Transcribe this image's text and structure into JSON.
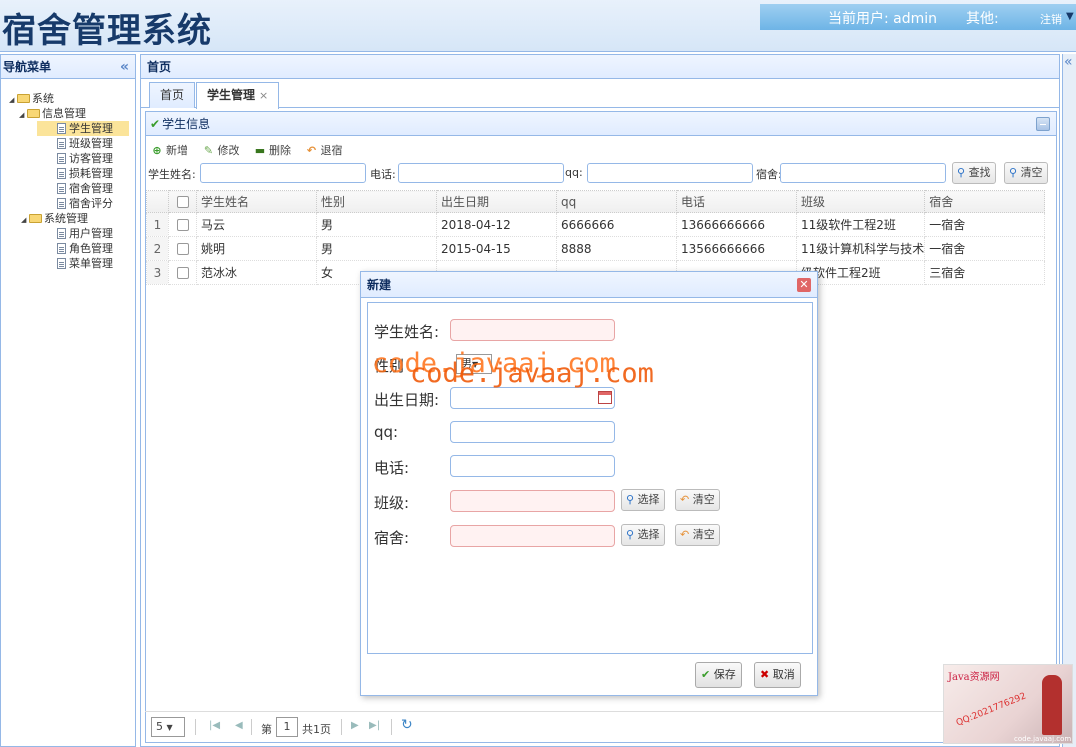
{
  "header": {
    "title": "宿舍管理系统",
    "current_user_label": "当前用户: admin",
    "other_label": "其他:",
    "logout_label": "注销"
  },
  "sidebar": {
    "title": "导航菜单",
    "tree": [
      {
        "label": "系统",
        "level": 0,
        "type": "folder"
      },
      {
        "label": "信息管理",
        "level": 1,
        "type": "folder"
      },
      {
        "label": "学生管理",
        "level": 2,
        "type": "file",
        "selected": true
      },
      {
        "label": "班级管理",
        "level": 2,
        "type": "file"
      },
      {
        "label": "访客管理",
        "level": 2,
        "type": "file"
      },
      {
        "label": "损耗管理",
        "level": 2,
        "type": "file"
      },
      {
        "label": "宿舍管理",
        "level": 2,
        "type": "file"
      },
      {
        "label": "宿舍评分",
        "level": 2,
        "type": "file"
      },
      {
        "label": "系统管理",
        "level": 1,
        "type": "folder"
      },
      {
        "label": "用户管理",
        "level": 2,
        "type": "file"
      },
      {
        "label": "角色管理",
        "level": 2,
        "type": "file"
      },
      {
        "label": "菜单管理",
        "level": 2,
        "type": "file"
      }
    ]
  },
  "main": {
    "title": "首页",
    "tabs": [
      {
        "label": "首页"
      },
      {
        "label": "学生管理",
        "closable": "×"
      }
    ],
    "panel_title": "学生信息",
    "toolbar": {
      "add": "新增",
      "edit": "修改",
      "delete": "删除",
      "back": "退宿"
    },
    "search": {
      "name_label": "学生姓名:",
      "phone_label": "电话:",
      "qq_label": "qq:",
      "dorm_label": "宿舍:",
      "find_button": "查找",
      "clear_button": "清空"
    },
    "table": {
      "columns": [
        "学生姓名",
        "性别",
        "出生日期",
        "qq",
        "电话",
        "班级",
        "宿舍"
      ],
      "rows": [
        {
          "num": "1",
          "cells": [
            "马云",
            "男",
            "2018-04-12",
            "6666666",
            "13666666666",
            "11级软件工程2班",
            "一宿舍"
          ]
        },
        {
          "num": "2",
          "cells": [
            "姚明",
            "男",
            "2015-04-15",
            "8888",
            "13566666666",
            "11级计算机科学与技术",
            "一宿舍"
          ]
        },
        {
          "num": "3",
          "cells": [
            "范冰冰",
            "女",
            "",
            "",
            "",
            "级软件工程2班",
            "三宿舍"
          ]
        }
      ]
    },
    "pager": {
      "page_size": "5",
      "page_prefix": "第",
      "page_value": "1",
      "page_total": "共1页"
    }
  },
  "dialog": {
    "title": "新建",
    "fields": {
      "name": "学生姓名:",
      "sex": "性别",
      "sex_value": "男",
      "birth": "出生日期:",
      "qq": "qq:",
      "phone": "电话:",
      "class": "班级:",
      "dorm": "宿舍:"
    },
    "select_button": "选择",
    "clear_button": "清空",
    "save_button": "保存",
    "cancel_button": "取消"
  },
  "watermark": "code.javaaj.com",
  "corner_ad": {
    "title": "Java资源网",
    "qq": "QQ:2021776292",
    "site": "code.javaaj.com"
  },
  "colors": {
    "accent": "#95b8e7",
    "header_bar": "#6eb4e6",
    "selected_tree": "#fbe49a",
    "required_field": "#fff2f2",
    "watermark": "#ff6e14"
  }
}
